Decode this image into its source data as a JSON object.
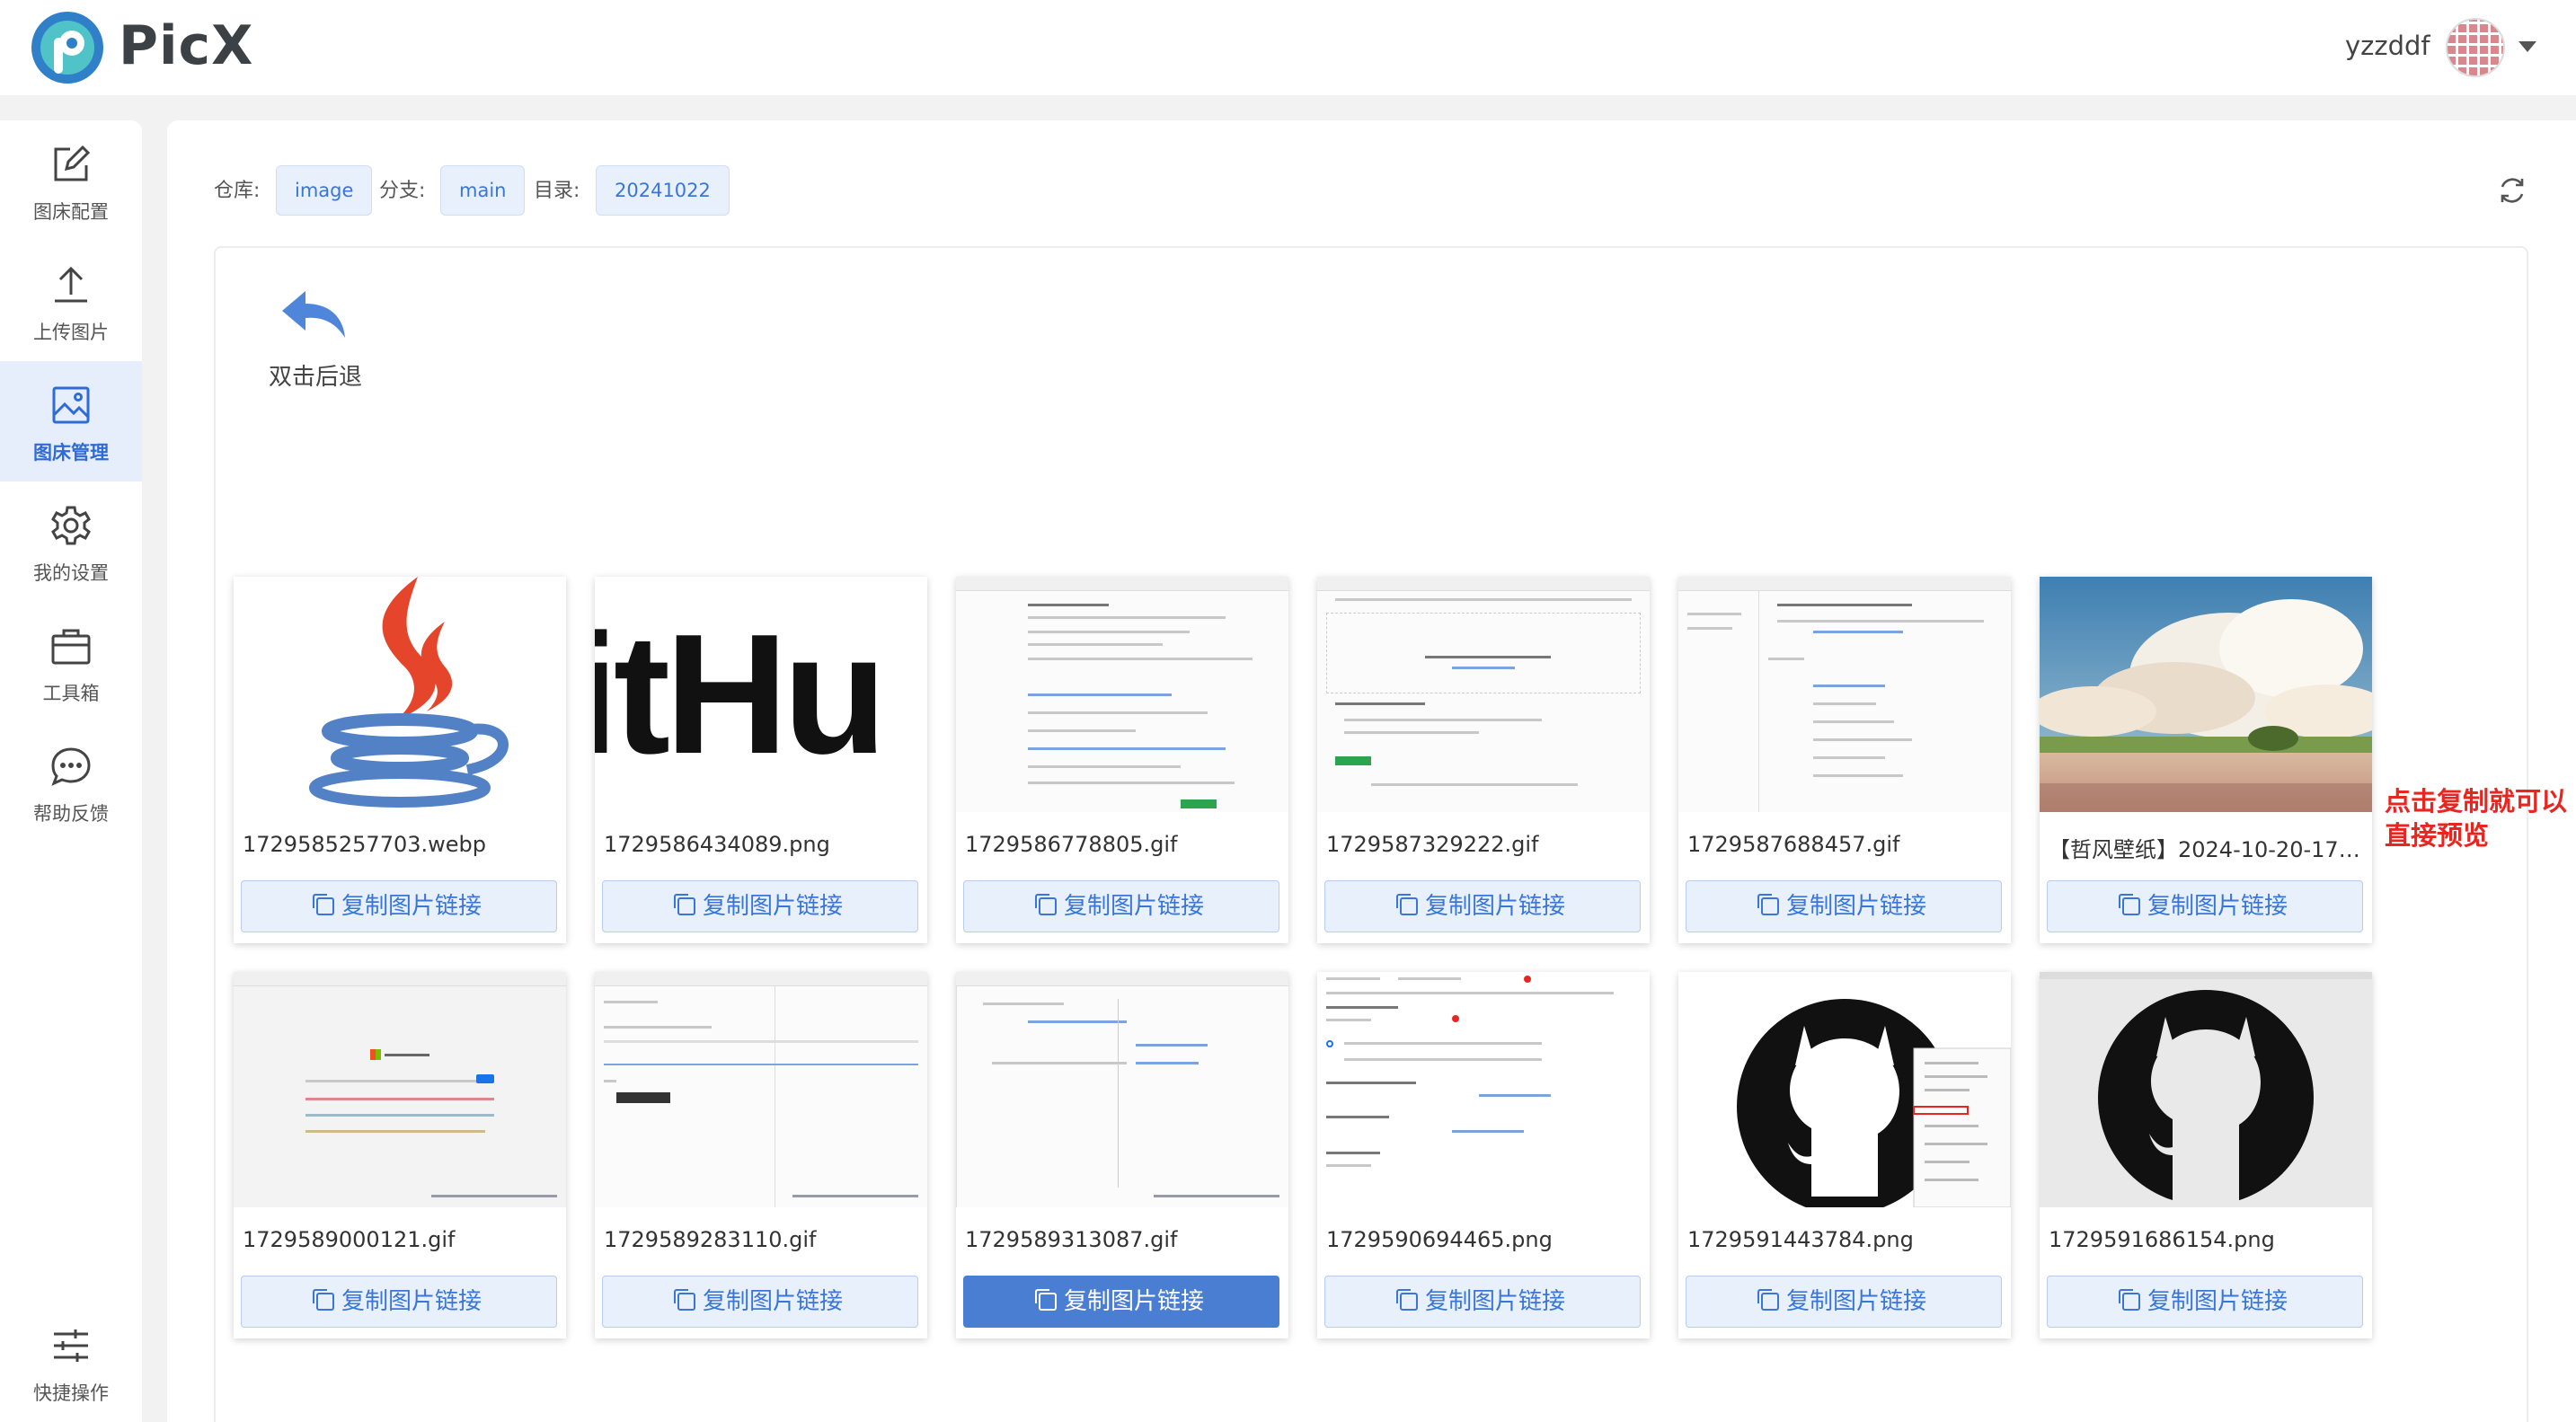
{
  "app": {
    "name": "PicX"
  },
  "header": {
    "username": "yzzddf"
  },
  "sidebar": {
    "items": [
      {
        "label": "图床配置",
        "icon": "edit-icon"
      },
      {
        "label": "上传图片",
        "icon": "upload-icon"
      },
      {
        "label": "图床管理",
        "icon": "image-icon",
        "active": true
      },
      {
        "label": "我的设置",
        "icon": "gear-icon"
      },
      {
        "label": "工具箱",
        "icon": "toolbox-icon"
      },
      {
        "label": "帮助反馈",
        "icon": "chat-icon"
      }
    ],
    "bottom": {
      "label": "快捷操作",
      "icon": "sliders-icon"
    }
  },
  "breadcrumb": {
    "repo_label": "仓库:",
    "repo": "image",
    "branch_label": "分支:",
    "branch": "main",
    "dir_label": "目录:",
    "dir": "20241022"
  },
  "back": {
    "label": "双击后退"
  },
  "copy_label": "复制图片链接",
  "annotation": "点击复制就可以直接预览",
  "images": [
    {
      "name": "1729585257703.webp",
      "kind": "java-logo"
    },
    {
      "name": "1729586434089.png",
      "kind": "github-text",
      "text": "itHu"
    },
    {
      "name": "1729586778805.gif",
      "kind": "screenshot"
    },
    {
      "name": "1729587329222.gif",
      "kind": "screenshot"
    },
    {
      "name": "1729587688457.gif",
      "kind": "screenshot"
    },
    {
      "name": "【哲风壁纸】2024-10-20-17_...",
      "kind": "landscape"
    },
    {
      "name": "1729589000121.gif",
      "kind": "screenshot"
    },
    {
      "name": "1729589283110.gif",
      "kind": "screenshot"
    },
    {
      "name": "1729589313087.gif",
      "kind": "screenshot",
      "button_active": true
    },
    {
      "name": "1729590694465.png",
      "kind": "screenshot"
    },
    {
      "name": "1729591443784.png",
      "kind": "github-logo"
    },
    {
      "name": "1729591686154.png",
      "kind": "github-logo"
    }
  ],
  "colors": {
    "accent": "#3a76d8",
    "annotation": "#e8261f",
    "active_bg": "#e6eefc"
  }
}
